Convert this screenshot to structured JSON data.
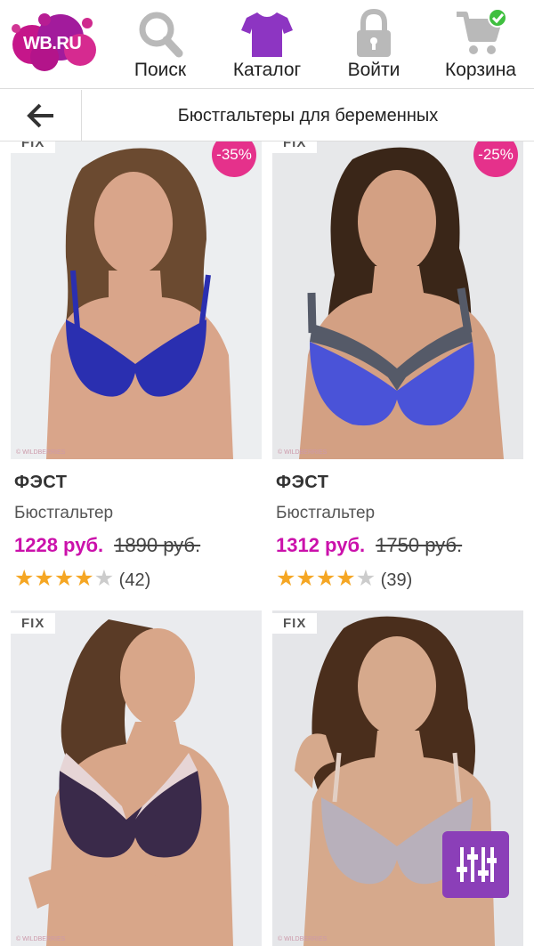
{
  "header": {
    "logo_text": "WB.RU",
    "nav": [
      {
        "label": "Поиск",
        "icon": "search-icon"
      },
      {
        "label": "Каталог",
        "icon": "shirt-icon"
      },
      {
        "label": "Войти",
        "icon": "lock-icon"
      },
      {
        "label": "Корзина",
        "icon": "cart-icon"
      }
    ]
  },
  "subheader": {
    "title": "Бюстгальтеры для беременных",
    "back_icon": "arrow-left-icon"
  },
  "products": [
    {
      "badge": "FIX",
      "discount": "-35%",
      "brand": "ФЭСТ",
      "type": "Бюстгальтер",
      "price": "1228 руб.",
      "old_price": "1890 руб.",
      "rating": 4,
      "reviews": "(42)",
      "watermark": "© WILDBERRIES",
      "bra_color": "#2a2fb0"
    },
    {
      "badge": "FIX",
      "discount": "-25%",
      "brand": "ФЭСТ",
      "type": "Бюстгальтер",
      "price": "1312 руб.",
      "old_price": "1750 руб.",
      "rating": 4,
      "reviews": "(39)",
      "watermark": "© WILDBERRIES",
      "bra_color": "#4a53d8"
    },
    {
      "badge": "FIX",
      "watermark": "© WILDBERRIES",
      "bra_color": "#3a2a4a"
    },
    {
      "badge": "FIX",
      "watermark": "© WILDBERRIES",
      "bra_color": "#b8b0bb"
    }
  ],
  "colors": {
    "price": "#cb11ab",
    "discount_badge": "#e5318b",
    "star": "#f5a623",
    "filter_button": "#8b3fb8"
  },
  "filter_icon": "filter-sliders-icon"
}
